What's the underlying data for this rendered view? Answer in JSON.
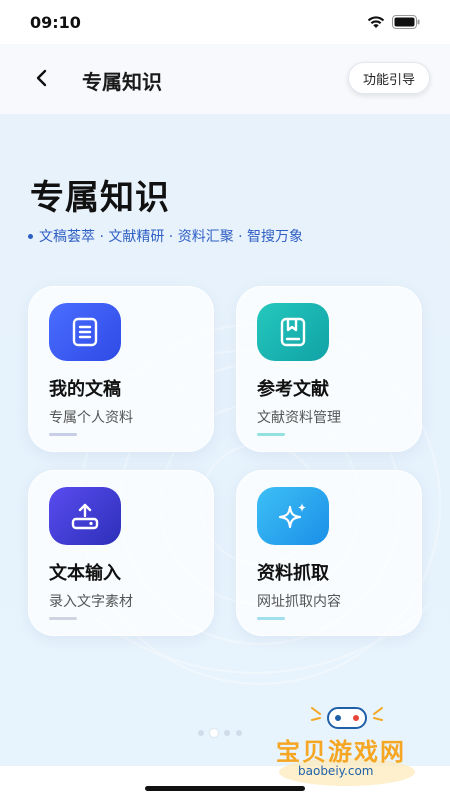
{
  "status_bar": {
    "time": "09:10"
  },
  "nav": {
    "title": "专属知识",
    "guide_label": "功能引导"
  },
  "main": {
    "title": "专属知识",
    "tagline": "文稿荟萃 · 文献精研 · 资料汇聚 · 智搜万象"
  },
  "cards": [
    {
      "title": "我的文稿",
      "subtitle": "专属个人资料",
      "icon": "document-icon",
      "color": "#3b5cf5",
      "bar": "#c8cde8"
    },
    {
      "title": "参考文献",
      "subtitle": "文献资料管理",
      "icon": "bookmark-book-icon",
      "color": "#18b7b0",
      "bar": "#92e0e0"
    },
    {
      "title": "文本输入",
      "subtitle": "录入文字素材",
      "icon": "upload-icon",
      "color": "#4a3fd9",
      "bar": "#cfd4e0"
    },
    {
      "title": "资料抓取",
      "subtitle": "网址抓取内容",
      "icon": "sparkle-icon",
      "color": "#2aa6ef",
      "bar": "#9fe0ec"
    }
  ],
  "pager": {
    "count": 4,
    "active": 1
  },
  "watermark": {
    "text": "宝贝游戏网",
    "url": "baobeiy.com"
  }
}
